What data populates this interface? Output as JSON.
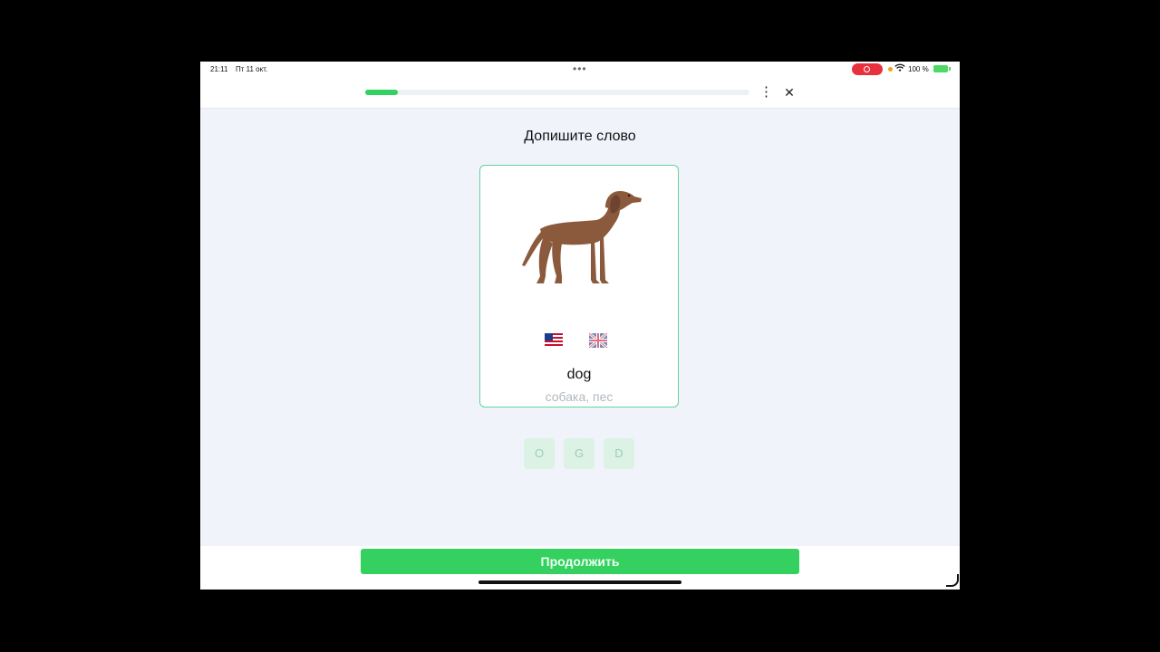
{
  "status_bar": {
    "time": "21:11",
    "date": "Пт 11 окт.",
    "dots": "•••",
    "battery_percent": "100 %",
    "battery_color": "#4cd964",
    "record_color": "#e8313d",
    "wifi_icon": "wifi-icon"
  },
  "lesson": {
    "progress_fraction": 0.085,
    "progress_color": "#34d060",
    "menu_icon": "⋮",
    "close_icon": "✕"
  },
  "exercise": {
    "title": "Допишите слово",
    "image": "dog-illustration",
    "flags": [
      "us-flag-icon",
      "uk-flag-icon"
    ],
    "word": "dog",
    "translation": "собака, пес",
    "letters": [
      "O",
      "G",
      "D"
    ]
  },
  "footer": {
    "continue_label": "Продолжить",
    "accent": "#34d060"
  }
}
